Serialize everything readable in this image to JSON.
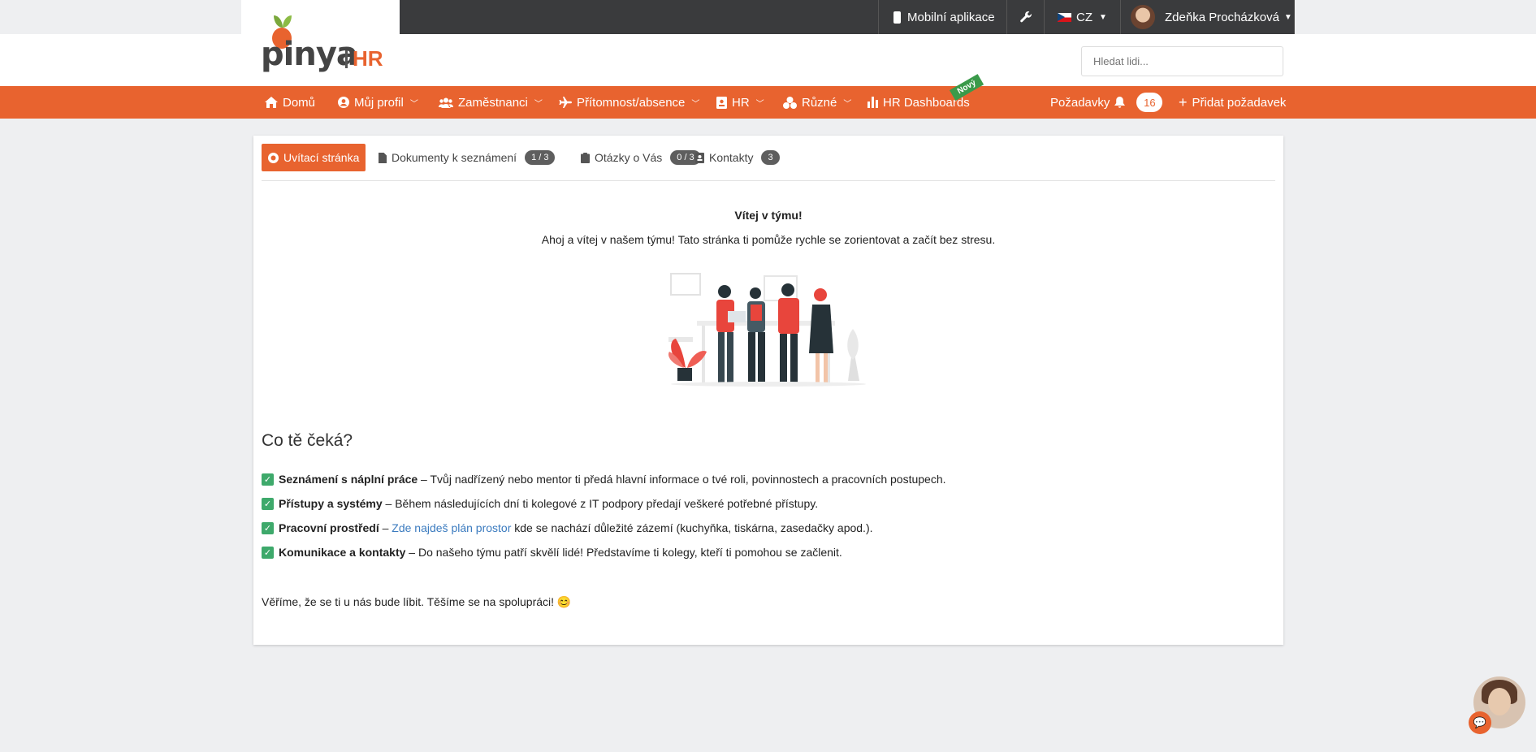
{
  "colors": {
    "accent": "#e8632f",
    "topbar": "#3a3b3d",
    "success": "#3ea96b",
    "link": "#3b7bbf",
    "new_badge": "#3a9a4a"
  },
  "logo": {
    "brand": "pinya",
    "suffix": "HR"
  },
  "topbar": {
    "mobile_app": "Mobilní aplikace",
    "tools_icon": "wrench-icon",
    "language": "CZ",
    "user_name": "Zdeňka Procházková"
  },
  "search": {
    "placeholder": "Hledat lidi..."
  },
  "nav": {
    "items": [
      {
        "label": "Domů",
        "icon": "home-icon"
      },
      {
        "label": "Můj profil",
        "icon": "user-circle-icon"
      },
      {
        "label": "Zaměstnanci",
        "icon": "users-icon"
      },
      {
        "label": "Přítomnost/absence",
        "icon": "plane-icon"
      },
      {
        "label": "HR",
        "icon": "id-card-icon"
      },
      {
        "label": "Různé",
        "icon": "cubes-icon"
      },
      {
        "label": "HR Dashboards",
        "icon": "bar-chart-icon"
      }
    ],
    "new_badge": "Nový",
    "requests_label": "Požadavky",
    "requests_count": "16",
    "add_request": "Přidat požadavek"
  },
  "tabs": [
    {
      "label": "Uvítací stránka",
      "icon": "sun-icon"
    },
    {
      "label": "Dokumenty k seznámení",
      "icon": "file-icon",
      "count": "1 / 3"
    },
    {
      "label": "Otázky o Vás",
      "icon": "clipboard-icon",
      "count": "0 / 3"
    },
    {
      "label": "Kontakty",
      "icon": "address-book-icon",
      "count": "3"
    }
  ],
  "welcome": {
    "title": "Vítej v týmu!",
    "subtitle": "Ahoj a vítej v našem týmu! Tato stránka ti pomůže rychle se zorientovat a začít bez stresu."
  },
  "section": {
    "heading": "Co tě čeká?",
    "items": [
      {
        "bold": "Seznámení s náplní práce",
        "text": " – Tvůj nadřízený nebo mentor ti předá hlavní informace o tvé roli, povinnostech a pracovních postupech."
      },
      {
        "bold": "Přístupy a systémy",
        "text": " – Během následujících dní ti kolegové z IT podpory předají veškeré potřebné přístupy."
      },
      {
        "bold": "Pracovní prostředí",
        "text": " – ",
        "link": "Zde najdeš plán prostor",
        "text2": " kde se nachází důležité zázemí (kuchyňka, tiskárna, zasedačky apod.)."
      },
      {
        "bold": "Komunikace a kontakty",
        "text": " – Do našeho týmu patří skvělí lidé! Představíme ti kolegy, kteří ti pomohou se začlenit."
      }
    ],
    "closing": "Věříme, že se ti u nás bude líbit. Těšíme se na spolupráci! 😊"
  }
}
